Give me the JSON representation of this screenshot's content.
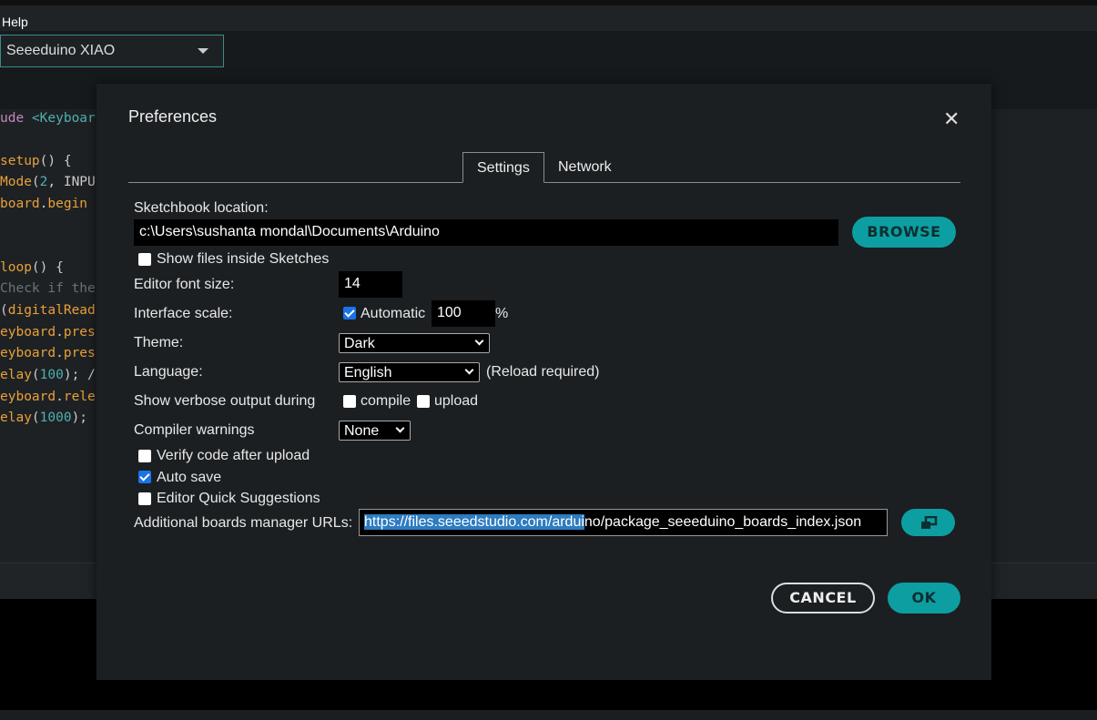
{
  "menu": {
    "help": "Help"
  },
  "board": {
    "selected": "Seeeduino XIAO"
  },
  "code_lines": [
    {
      "parts": [
        [
          "ude ",
          "#c586c0"
        ],
        [
          "<Keyboar",
          "#4fb0b0"
        ]
      ]
    },
    {
      "parts": [
        [
          "setup",
          "#e8a13a"
        ],
        [
          "() {",
          "#cccccc"
        ]
      ]
    },
    {
      "parts": [
        [
          "Mode",
          "#e8a13a"
        ],
        [
          "(",
          "#ccc"
        ],
        [
          "2",
          "#4fb0b0"
        ],
        [
          ", INPU",
          "#ccc"
        ]
      ]
    },
    {
      "parts": [
        [
          "board",
          "#e8a13a"
        ],
        [
          ".",
          "#ccc"
        ],
        [
          "begin",
          "#e8a13a"
        ]
      ]
    },
    {
      "parts": [
        [
          "loop",
          "#e8a13a"
        ],
        [
          "() {",
          "#cccccc"
        ]
      ]
    },
    {
      "parts": [
        [
          "Check if the",
          "#6b7378"
        ]
      ]
    },
    {
      "parts": [
        [
          "(",
          "#ccc"
        ],
        [
          "digitalRead",
          "#e8a13a"
        ]
      ]
    },
    {
      "parts": [
        [
          "eyboard",
          "#e8a13a"
        ],
        [
          ".",
          "#ccc"
        ],
        [
          "pres",
          "#e8a13a"
        ]
      ]
    },
    {
      "parts": [
        [
          "eyboard",
          "#e8a13a"
        ],
        [
          ".",
          "#ccc"
        ],
        [
          "pres",
          "#e8a13a"
        ]
      ]
    },
    {
      "parts": [
        [
          "elay",
          "#e8a13a"
        ],
        [
          "(",
          "#ccc"
        ],
        [
          "100",
          "#4fb0b0"
        ],
        [
          "); /",
          "#ccc"
        ]
      ]
    },
    {
      "parts": [
        [
          "eyboard",
          "#e8a13a"
        ],
        [
          ".",
          "#ccc"
        ],
        [
          "rele",
          "#e8a13a"
        ]
      ]
    },
    {
      "parts": [
        [
          "elay",
          "#e8a13a"
        ],
        [
          "(",
          "#ccc"
        ],
        [
          "1000",
          "#4fb0b0"
        ],
        [
          ");",
          "#ccc"
        ]
      ]
    }
  ],
  "dialog": {
    "title": "Preferences",
    "close_icon": "close-icon",
    "tabs": [
      {
        "label": "Settings",
        "active": true
      },
      {
        "label": "Network",
        "active": false
      }
    ],
    "sketchbook_label": "Sketchbook location:",
    "sketchbook_value": "c:\\Users\\sushanta mondal\\Documents\\Arduino",
    "browse": "BROWSE",
    "show_files": {
      "label": "Show files inside Sketches",
      "checked": false
    },
    "font_size_label": "Editor font size:",
    "font_size_value": "14",
    "scale_label": "Interface scale:",
    "scale_auto": {
      "label": "Automatic",
      "checked": true
    },
    "scale_value": "100",
    "scale_unit": "%",
    "theme_label": "Theme:",
    "theme_value": "Dark",
    "language_label": "Language:",
    "language_value": "English",
    "language_note": "(Reload required)",
    "verbose_label": "Show verbose output during",
    "verbose_compile": {
      "label": "compile",
      "checked": false
    },
    "verbose_upload": {
      "label": "upload",
      "checked": false
    },
    "warnings_label": "Compiler warnings",
    "warnings_value": "None",
    "verify": {
      "label": "Verify code after upload",
      "checked": false
    },
    "autosave": {
      "label": "Auto save",
      "checked": true
    },
    "quick": {
      "label": "Editor Quick Suggestions",
      "checked": false
    },
    "urls_label": "Additional boards manager URLs:",
    "urls_selected": "https://files.seeedstudio.com/ardui",
    "urls_rest": "no/package_seeeduino_boards_index.json",
    "urls_button_icon": "open-window-icon",
    "cancel": "CANCEL",
    "ok": "OK"
  },
  "colors": {
    "accent": "#0d9ea2",
    "dialog_bg": "#1b1f22",
    "selection": "#2d7cc0"
  }
}
